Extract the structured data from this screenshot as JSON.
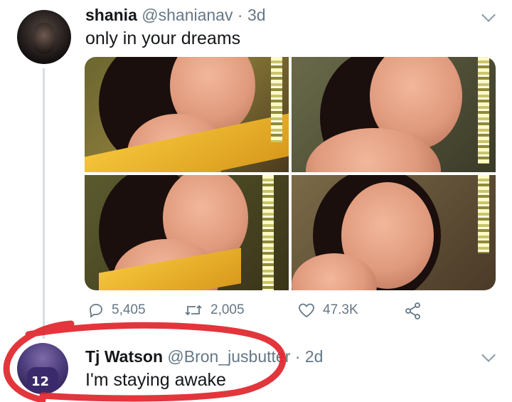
{
  "tweet": {
    "author_name": "shania",
    "author_handle": "@shanianav",
    "separator": " · ",
    "age": "3d",
    "text": "only in your dreams",
    "avatar_icon": "profile-photo",
    "media_count": 4
  },
  "actions": {
    "reply_count": "5,405",
    "retweet_count": "2,005",
    "like_count": "47.3K",
    "icons": [
      "reply-icon",
      "retweet-icon",
      "like-icon",
      "share-icon"
    ]
  },
  "reply": {
    "author_name": "Tj Watson",
    "author_handle": "@Bron_jusbutter",
    "separator": " · ",
    "age": "2d",
    "text": "I'm staying awake",
    "avatar_icon": "profile-photo-jersey"
  },
  "colors": {
    "text_primary": "#14171a",
    "text_secondary": "#657786",
    "thread_line": "#d6dde3",
    "scribble_red": "#e0252b"
  }
}
